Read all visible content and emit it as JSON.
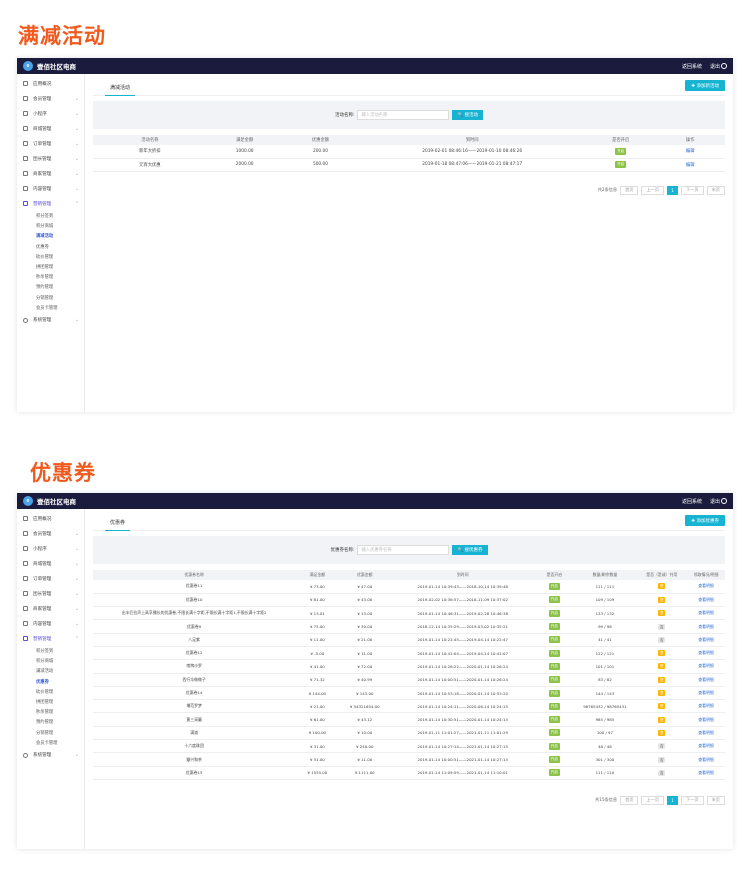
{
  "section1_title": "满减活动",
  "section2_title": "优惠券",
  "topbar": {
    "brand": "壹佰社区电商",
    "link": "返回系统",
    "logout": "退出"
  },
  "sidebar": {
    "items": [
      "应用概况",
      "会员管理",
      "小程序",
      "商城管理",
      "订单管理",
      "团长管理",
      "商家管理",
      "内容管理",
      "营销管理"
    ],
    "sub_items": [
      "积分签到",
      "积分商城",
      "满减活动",
      "优惠券",
      "砍价管理",
      "拼团管理",
      "秒杀管理",
      "预约管理",
      "分销管理",
      "会员卡管理"
    ],
    "last_item": "系统管理"
  },
  "s1": {
    "tab": "满减活动",
    "add_label": "✚ 添加新活动",
    "search_label": "活动名称:",
    "search_placeholder": "输入活动名称",
    "search_btn": "🔍 搜活动",
    "headers": [
      "活动名称",
      "满足金额",
      "优惠金额",
      "到时间",
      "是否开启",
      "操作"
    ],
    "rows": [
      [
        "新年大折扣",
        "1000.00",
        "200.00",
        "2019-02-01 08:46:16——2019-01-10 08:46:26",
        "开启",
        "编辑"
      ],
      [
        "元宵大优惠",
        "2000.00",
        "500.00",
        "2019-01-18 08:47:06——2019-01-21 08:47:17",
        "开启",
        "编辑"
      ]
    ],
    "pager": {
      "total": "共2条信息",
      "first": "首页",
      "prev": "上一页",
      "cur": "1",
      "next": "下一页",
      "last": "末页"
    }
  },
  "s2": {
    "tab": "优惠券",
    "add_label": "✚ 添加优惠券",
    "search_label": "优惠券名称:",
    "search_placeholder": "输入优惠券名称",
    "search_btn": "🔍 搜优惠券",
    "headers": [
      "优惠券名称",
      "满足金额",
      "优惠金额",
      "到时间",
      "是否开启",
      "数量/剩余数量",
      "是否（是或）共用",
      "领取情况/明细"
    ],
    "rows": [
      [
        "优惠卷11",
        "¥ 73.00",
        "¥ 47.00",
        "2019-01-14 10:39:43——2018-10-14 10:39:48",
        "开启",
        "111 / 111",
        "是",
        "查看明细"
      ],
      [
        "优惠卷10",
        "¥ 81.00",
        "¥ 43.00",
        "2019-02-02 10:36:57——2018-11-09 10:37:02",
        "开启",
        "109 / 109",
        "是",
        "查看明细"
      ],
      [
        "出丰匹拉声上高孚播长的优惠卷,不限长满十字距,不限长满十字距1,不限长满十字距2",
        "¥ 13.01",
        "¥ 13.00",
        "2019-01-14 10:46:31——2019-02-28 10:46:38",
        "开启",
        "133 / 132",
        "是",
        "查看明细"
      ],
      [
        "优惠卷9",
        "¥ 75.00",
        "¥ 30.00",
        "2018-12-14 10:35:29——2019-03-02 10:35:21",
        "开启",
        "99 / 98",
        "否",
        "查看明细"
      ],
      [
        "八足紫",
        "¥ 11.00",
        "¥ 21.00",
        "2019-01-14 10:22:45——2019-04-14 10:22:47",
        "开启",
        "41 / 41",
        "否",
        "查看明细"
      ],
      [
        "优惠卷12",
        "¥ -5.00",
        "¥ 11.00",
        "2019-01-14 10:41:04——2019-04-14 10:41:07",
        "开启",
        "122 / 121",
        "是",
        "查看明细"
      ],
      [
        "南掏沙罗",
        "¥ 41.00",
        "¥ 72.00",
        "2019-01-14 10:26:22——2020-01-14 10:26:24",
        "开启",
        "101 / 101",
        "是",
        "查看明细"
      ],
      [
        "西行伞做做子",
        "¥ 71.32",
        "¥ 40.99",
        "2019-01-14 10:00:51——2020-01-14 10:26:24",
        "开启",
        "83 / 82",
        "是",
        "查看明细"
      ],
      [
        "优惠卷14",
        "¥ 144.00",
        "¥ 143.00",
        "2019-01-14 10:53:18——2020-01-14 10:53:20",
        "开启",
        "144 / 143",
        "是",
        "查看明细"
      ],
      [
        "埔范罗梦",
        "¥ 21.00",
        "¥ 54321654.00",
        "2019-01-14 10:24:11——2020-06-14 10:24:15",
        "开启",
        "98765432 / 98765431",
        "是",
        "查看明细"
      ],
      [
        "黄三采蘑",
        "¥ 61.00",
        "¥ 43.12",
        "2019-01-14 10:30:51——2020-01-14 10:24:15",
        "开启",
        "985 / 985",
        "是",
        "查看明细"
      ],
      [
        "满减",
        "¥ 100.00",
        "¥ 10.00",
        "2019-01-11 11:01:27——2021-01-11 11:01:29",
        "开启",
        "100 / 97",
        "是",
        "查看明细"
      ],
      [
        "十六度珠团",
        "¥ 31.00",
        "¥ 240.00",
        "2019-01-14 10:27:14——2021-01-14 10:27:15",
        "开启",
        "48 / 48",
        "否",
        "查看明细"
      ],
      [
        "瓣兴和茶",
        "¥ 51.00",
        "¥ 11.00",
        "2019-01-14 10:00:51——2021-01-14 10:27:15",
        "开启",
        "301 / 300",
        "否",
        "查看明细"
      ],
      [
        "优惠卷15",
        "¥ 1555.00",
        "¥ 1111.00",
        "2019-01-14 11:09:59——2021-01-14 11:10:01",
        "开启",
        "111 / 110",
        "否",
        "查看明细"
      ]
    ],
    "pager": {
      "total": "共15条信息",
      "first": "首页",
      "prev": "上一页",
      "cur": "1",
      "next": "下一页",
      "last": "末页"
    }
  }
}
